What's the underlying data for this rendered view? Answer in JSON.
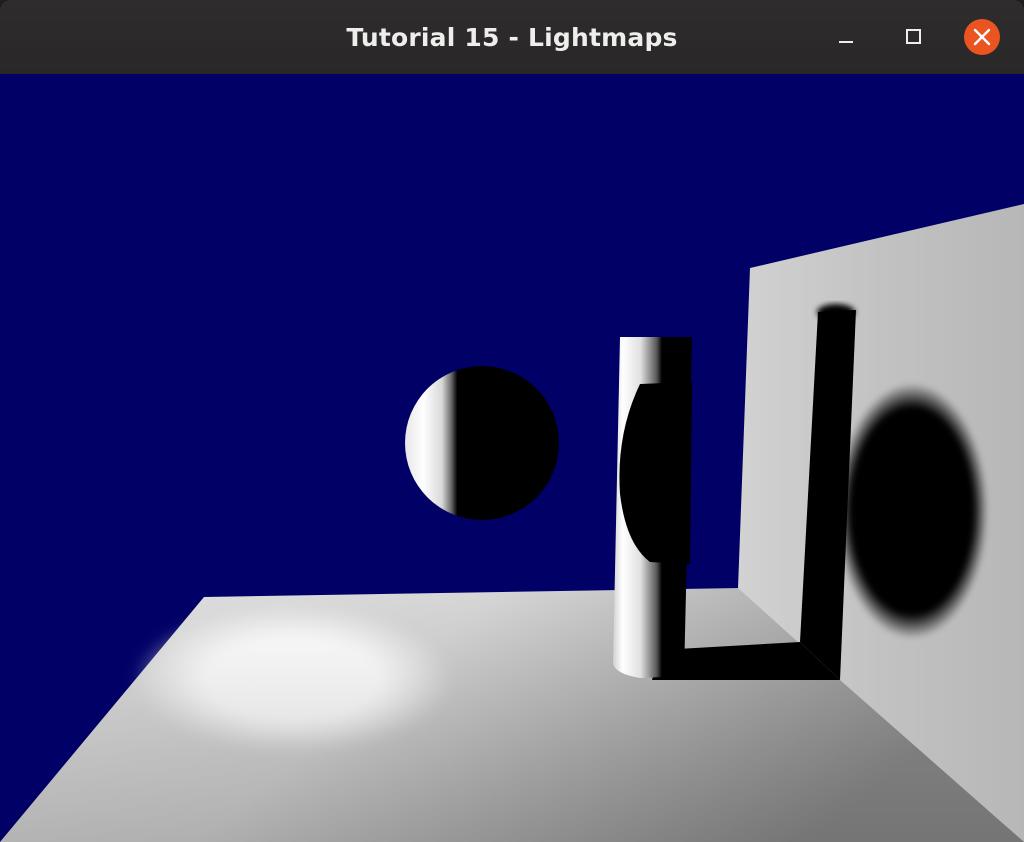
{
  "window": {
    "title": "Tutorial 15 - Lightmaps",
    "controls": {
      "minimize_icon": "minimize-icon",
      "maximize_icon": "maximize-icon",
      "close_icon": "close-icon"
    }
  },
  "colors": {
    "titlebar": "#2b2929",
    "title_text": "#eeeeec",
    "close_button": "#e95420",
    "scene_background": "#000066",
    "shadow": "#000000",
    "surface_light": "#ffffff",
    "surface_mid": "#bdbdbd"
  }
}
